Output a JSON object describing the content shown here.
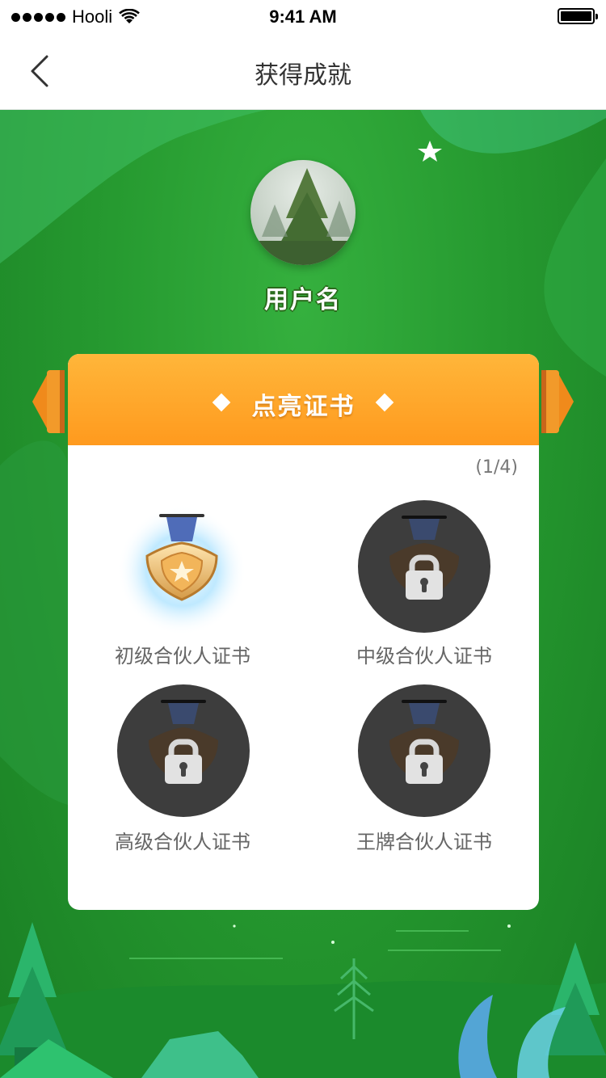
{
  "status_bar": {
    "carrier": "Hooli",
    "time": "9:41 AM"
  },
  "nav": {
    "title": "获得成就"
  },
  "profile": {
    "username": "用户名"
  },
  "card": {
    "title": "点亮证书",
    "progress": "(1/4)",
    "certificates": [
      {
        "label": "初级合伙人证书",
        "unlocked": true
      },
      {
        "label": "中级合伙人证书",
        "unlocked": false
      },
      {
        "label": "高级合伙人证书",
        "unlocked": false
      },
      {
        "label": "王牌合伙人证书",
        "unlocked": false
      }
    ]
  },
  "colors": {
    "accent": "#ff9a1e",
    "background": "#269a30"
  }
}
